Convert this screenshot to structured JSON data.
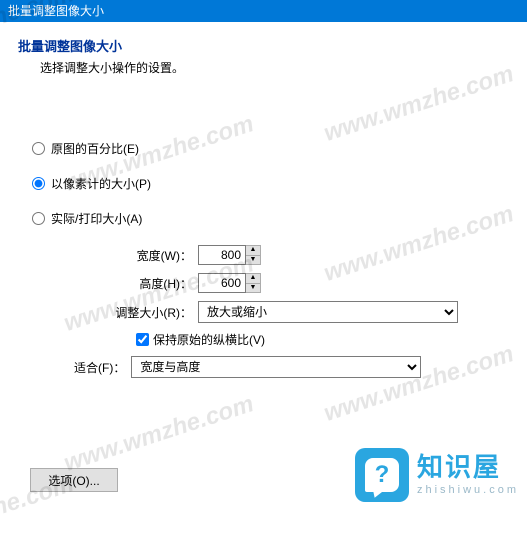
{
  "window": {
    "title": "批量调整图像大小"
  },
  "page": {
    "title": "批量调整图像大小",
    "subtitle": "选择调整大小操作的设置。"
  },
  "radios": {
    "percent": {
      "label": "原图的百分比(E)",
      "checked": false
    },
    "pixels": {
      "label": "以像素计的大小(P)",
      "checked": true
    },
    "print": {
      "label": "实际/打印大小(A)",
      "checked": false
    }
  },
  "fields": {
    "width": {
      "label": "宽度(W)：",
      "value": "800"
    },
    "height": {
      "label": "高度(H)：",
      "value": "600"
    },
    "resize": {
      "label": "调整大小(R)：",
      "value": "放大或缩小"
    },
    "keepratio": {
      "label": "保持原始的纵横比(V)",
      "checked": true
    },
    "fit": {
      "label": "适合(F)：",
      "value": "宽度与高度"
    }
  },
  "buttons": {
    "options": "选项(O)..."
  },
  "watermark": "www.wmzhe.com",
  "logo": {
    "cn": "知识屋",
    "en": "zhishiwu.com",
    "q": "?"
  }
}
